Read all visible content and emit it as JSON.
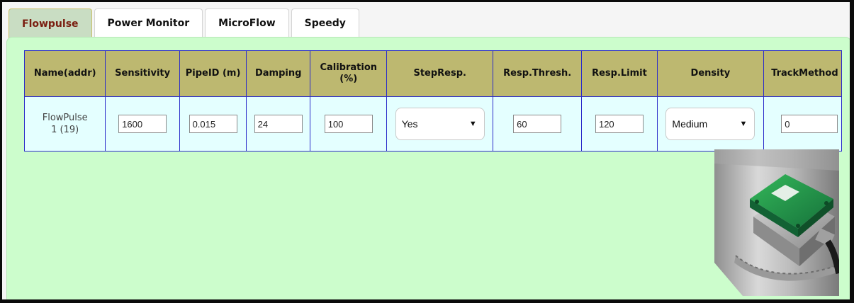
{
  "tabs": [
    {
      "label": "Flowpulse"
    },
    {
      "label": "Power Monitor"
    },
    {
      "label": "MicroFlow"
    },
    {
      "label": "Speedy"
    }
  ],
  "table": {
    "headers": {
      "name": "Name(addr)",
      "sensitivity": "Sensitivity",
      "pipeid": "PipeID (m)",
      "damping": "Damping",
      "calibration": "Calibration (%)",
      "stepresp": "StepResp.",
      "respthresh": "Resp.Thresh.",
      "resplimit": "Resp.Limit",
      "density": "Density",
      "trackmethod": "TrackMethod"
    },
    "row": {
      "name": "FlowPulse 1 (19)",
      "sensitivity": "1600",
      "pipeid": "0.015",
      "damping": "24",
      "calibration": "100",
      "stepresp": "Yes",
      "respthresh": "60",
      "resplimit": "120",
      "density": "Medium",
      "trackmethod": "0"
    }
  },
  "colors": {
    "active_tab_text": "#7a1e10",
    "header_bg": "#bdb870",
    "cell_bg": "#e4ffff",
    "panel_bg": "#ccfdcc",
    "grid_border": "#2b2bc9"
  }
}
